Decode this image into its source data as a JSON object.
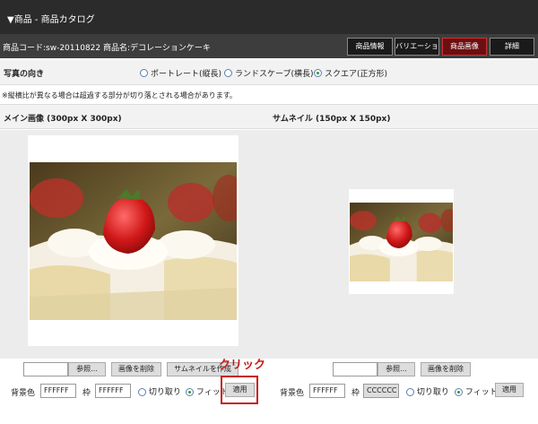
{
  "window": {
    "title": "▼商品 - 商品カタログ"
  },
  "product_bar": {
    "code_text": "商品コード:sw-20110822",
    "name_text": "商品名:デコレーションケーキ",
    "tabs": [
      {
        "label": "商品情報",
        "active": false
      },
      {
        "label": "バリエーション",
        "active": false
      },
      {
        "label": "商品画像",
        "active": true
      },
      {
        "label": "詳細",
        "active": false
      }
    ]
  },
  "orientation": {
    "label": "写真の向き",
    "options": [
      {
        "label": "ポートレート(縦長)",
        "selected": false
      },
      {
        "label": "ランドスケープ(横長)",
        "selected": false
      },
      {
        "label": "スクエア(正方形)",
        "selected": true
      }
    ]
  },
  "note": "※縦横比が異なる場合は超過する部分が切り落とされる場合があります。",
  "sections": {
    "main_title": "メイン画像 (300px X 300px)",
    "thumb_title": "サムネイル (150px X 150px)"
  },
  "main_controls": {
    "browse": "参照...",
    "delete": "画像を削除",
    "make_thumb": "サムネイルを作成",
    "bg_label": "背景色",
    "bg_value": "FFFFFF",
    "frame_label": "枠",
    "frame_value": "FFFFFF",
    "crop": "切り取り",
    "fit": "フィット",
    "fit_selected": true,
    "apply": "適用"
  },
  "thumb_controls": {
    "browse": "参照...",
    "delete": "画像を削除",
    "bg_label": "背景色",
    "bg_value": "FFFFFF",
    "frame_label": "枠",
    "frame_value": "CCCCCC",
    "crop": "切り取り",
    "fit": "フィット",
    "fit_selected": true,
    "apply": "適用"
  },
  "annotation": {
    "text": "クリック",
    "color": "#c61a1a"
  },
  "colors": {
    "active_tab": "#6b0f12",
    "title_bg": "#2b2b2b",
    "accent_red": "#c61a1a"
  }
}
